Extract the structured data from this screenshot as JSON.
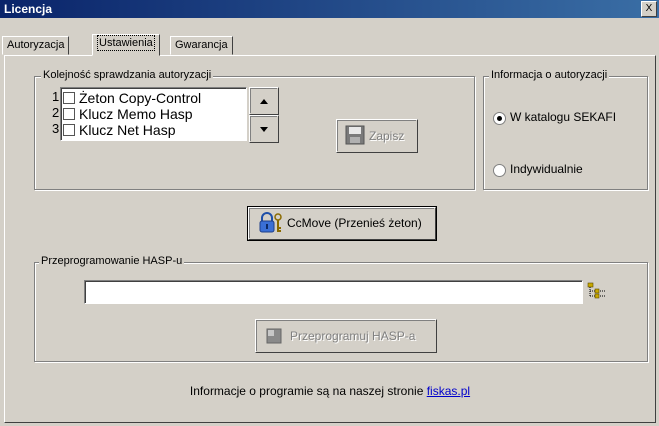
{
  "window": {
    "title": "Licencja",
    "close_glyph": "X"
  },
  "tabs": [
    {
      "label": "Autoryzacja"
    },
    {
      "label": "Ustawienia",
      "active": true
    },
    {
      "label": "Gwarancja"
    }
  ],
  "order_group": {
    "legend": "Kolejność sprawdzania autoryzacji",
    "items": [
      {
        "index": "1",
        "label": "Żeton Copy-Control",
        "checked": false
      },
      {
        "index": "2",
        "label": "Klucz Memo Hasp",
        "checked": false
      },
      {
        "index": "3",
        "label": "Klucz Net Hasp",
        "checked": false
      }
    ],
    "up_icon": "up-arrow-icon",
    "down_icon": "down-arrow-icon",
    "save_label": "Zapisz",
    "save_icon": "floppy-disk-icon"
  },
  "auth_group": {
    "legend": "Informacja o autoryzacji",
    "options": [
      {
        "label": "W katalogu SEKAFI",
        "selected": true
      },
      {
        "label": "Indywidualnie",
        "selected": false
      }
    ]
  },
  "ccmove": {
    "label": "CcMove (Przenieś żeton)",
    "icon": "padlock-key-icon"
  },
  "hasp_group": {
    "legend": "Przeprogramowanie HASP-u",
    "path_value": "",
    "browse_icon": "tree-browse-icon",
    "reprogram_label": "Przeprogramuj HASP-a"
  },
  "footer": {
    "text": "Informacje o programie są na naszej stronie",
    "link": "fiskas.pl"
  }
}
